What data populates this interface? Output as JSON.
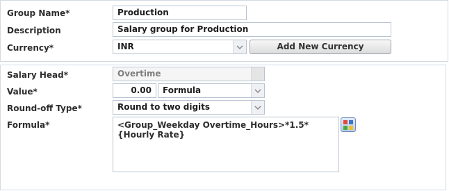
{
  "group": {
    "group_name_label": "Group Name*",
    "group_name_value": "Production",
    "description_label": "Description",
    "description_value": "Salary group for Production",
    "currency_label": "Currency*",
    "currency_value": "INR",
    "add_currency_label": "Add New Currency"
  },
  "salary_head": {
    "salary_head_label": "Salary Head*",
    "salary_head_value": "Overtime",
    "value_label": "Value*",
    "value_amount": "0.00",
    "value_type": "Formula",
    "roundoff_label": "Round-off Type*",
    "roundoff_value": "Round to two digits",
    "formula_label": "Formula*",
    "formula_value": "<Group_Weekday Overtime_Hours>*1.5*{Hourly Rate}"
  },
  "icons": {
    "dropdown": "chevron-down-icon",
    "calculator": "calculator-icon"
  },
  "colors": {
    "panel_border": "#d2dae4",
    "field_border": "#b9c4d1",
    "calc_blue": "#6f8db8"
  }
}
